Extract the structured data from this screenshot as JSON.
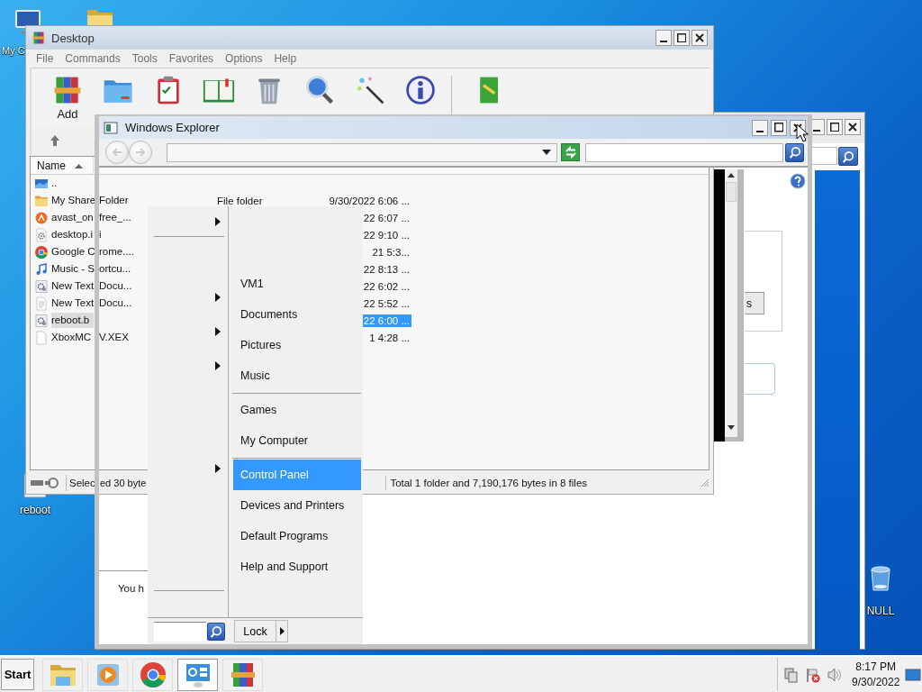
{
  "desktop_icons": [
    {
      "kind": "computer",
      "label": "My C"
    },
    {
      "kind": "folder"
    },
    {
      "kind": "script",
      "label": "reboot"
    },
    {
      "kind": "recycle_bin",
      "label": "NULL"
    }
  ],
  "back_window": {
    "button_label": "s",
    "text": "You h"
  },
  "winrar": {
    "title": "Desktop",
    "menu": [
      "File",
      "Commands",
      "Tools",
      "Favorites",
      "Options",
      "Help"
    ],
    "toolbar": [
      {
        "kind": "add",
        "label": "Add"
      },
      {
        "kind": "extract"
      },
      {
        "kind": "test"
      },
      {
        "kind": "view"
      },
      {
        "kind": "delete"
      },
      {
        "kind": "find"
      },
      {
        "kind": "wizard"
      },
      {
        "kind": "info"
      },
      {
        "kind": "repair"
      }
    ],
    "name_column": "Name",
    "rows": [
      {
        "kind": "up",
        "name": "..",
        "selected": false
      },
      {
        "kind": "folder",
        "name": "My Share",
        "name_rest": "Folder",
        "type": "File folder",
        "modified": "9/30/2022 6:06 ...",
        "selected": false
      },
      {
        "kind": "avast",
        "name": "avast_on",
        "name_rest": "free_...",
        "modified": "22 6:07 ...",
        "selected": false
      },
      {
        "kind": "ini",
        "name": "desktop.i",
        "name_rest": "i",
        "modified": "22 9:10 ...",
        "selected": false
      },
      {
        "kind": "chrome",
        "name": "Google C",
        "name_rest": "rome....",
        "modified": "21 5:3...",
        "selected": false
      },
      {
        "kind": "audio",
        "name": "Music - S",
        "name_rest": "ortcu...",
        "modified": "22 8:13 ...",
        "selected": false
      },
      {
        "kind": "script",
        "name": "New Text",
        "name_rest": "Docu...",
        "modified": "22 6:02 ...",
        "selected": false
      },
      {
        "kind": "text",
        "name": "New Text",
        "name_rest": "Docu...",
        "modified": "22 5:52 ...",
        "selected": false
      },
      {
        "kind": "script",
        "name": "reboot.b",
        "modified": "22 6:00 ...",
        "selected": true
      },
      {
        "kind": "file",
        "name": "XboxMC",
        "name_rest": "V.XEX",
        "modified": "1 4:28 ...",
        "selected": false
      }
    ],
    "status_parts": [
      "Selec",
      "ed 30 byte"
    ],
    "status_total": "Total 1 folder and 7,190,176 bytes in 8 files"
  },
  "explorer": {
    "title": "Windows Explorer"
  },
  "start_menu": {
    "groups": [
      [
        {
          "label": "VM1",
          "selected": false
        },
        {
          "label": "Documents",
          "selected": false
        },
        {
          "label": "Pictures",
          "selected": false
        },
        {
          "label": "Music",
          "selected": false
        }
      ],
      [
        {
          "label": "Games",
          "selected": false
        },
        {
          "label": "My Computer",
          "selected": false
        }
      ],
      [
        {
          "label": "Control Panel",
          "selected": true
        },
        {
          "label": "Devices and Printers",
          "selected": false
        },
        {
          "label": "Default Programs",
          "selected": false
        },
        {
          "label": "Help and Support",
          "selected": false
        }
      ]
    ],
    "lock": "Lock"
  },
  "taskbar": {
    "start": "Start",
    "apps": [
      {
        "kind": "explorer",
        "selected": false
      },
      {
        "kind": "media",
        "selected": false
      },
      {
        "kind": "chrome",
        "selected": false
      },
      {
        "kind": "control_panel",
        "selected": true
      },
      {
        "kind": "winrar",
        "selected": false
      }
    ],
    "time": "8:17 PM",
    "date": "9/30/2022"
  }
}
